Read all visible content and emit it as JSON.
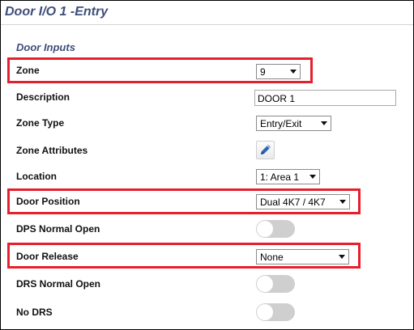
{
  "header": {
    "title": "Door I/O 1 -Entry"
  },
  "section": {
    "title": "Door Inputs"
  },
  "rows": {
    "zone": {
      "label": "Zone",
      "value": "9"
    },
    "description": {
      "label": "Description",
      "value": "DOOR 1"
    },
    "zone_type": {
      "label": "Zone Type",
      "value": "Entry/Exit"
    },
    "zone_attributes": {
      "label": "Zone Attributes",
      "icon": "pencil-edit-icon"
    },
    "location": {
      "label": "Location",
      "value": "1: Area 1"
    },
    "door_position": {
      "label": "Door Position",
      "value": "Dual 4K7 / 4K7"
    },
    "dps_normal_open": {
      "label": "DPS Normal Open",
      "state": "off"
    },
    "door_release": {
      "label": "Door Release",
      "value": "None"
    },
    "drs_normal_open": {
      "label": "DRS Normal Open",
      "state": "off"
    },
    "no_drs": {
      "label": "No DRS",
      "state": "off"
    }
  },
  "colors": {
    "title": "#3d4e7a",
    "highlight": "#e5202e",
    "toggle_off": "#cfcfcf",
    "edit_icon": "#2c66b8"
  }
}
